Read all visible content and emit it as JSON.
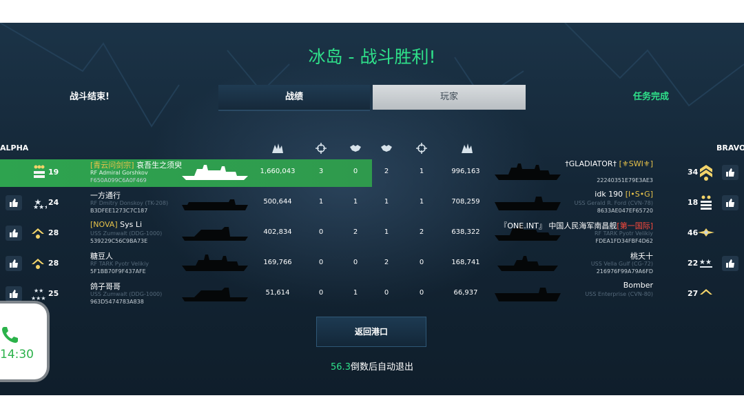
{
  "header": {
    "title": "冰岛 - 战斗胜利!"
  },
  "tabs": {
    "battle_over": "战斗结束!",
    "stats": "战绩",
    "players": "玩家",
    "mission": "任务完成"
  },
  "teams": {
    "alpha": "ALPHA",
    "bravo": "BRAVO"
  },
  "columns": [
    "damage-icon",
    "crosshair-icon",
    "handshake-icon",
    "handshake-icon",
    "crosshair-icon",
    "damage-icon"
  ],
  "rows": [
    {
      "left": {
        "level": "19",
        "clan": "[青云问剑宗]",
        "name": "哀吾生之须臾",
        "ship": "RF Admiral Gorshkov",
        "id": "F650A099C6A0F469"
      },
      "damage_left": "1,660,043",
      "k1": "3",
      "k2": "0",
      "k3": "2",
      "k4": "1",
      "damage_right": "996,163",
      "right": {
        "name": "†GLADIATOR†",
        "clan": "[⚜SWI⚜]",
        "ship": "",
        "id": "22240351E79E3AE3",
        "level": "34"
      }
    },
    {
      "left": {
        "level": "24",
        "clan": "",
        "name": "一方通行",
        "ship": "RF Dmitry Donskoy (TK-208)",
        "id": "B3DFEE1273C7C187"
      },
      "damage_left": "500,644",
      "k1": "1",
      "k2": "1",
      "k3": "1",
      "k4": "1",
      "damage_right": "708,259",
      "right": {
        "name": "idk 190",
        "clan": "[I•S•G]",
        "ship": "USS Gerald R. Ford (CVN-78)",
        "id": "8633AE047EF65720",
        "level": "18"
      }
    },
    {
      "left": {
        "level": "28",
        "clan": "[NOVA]",
        "name": "Sys Li",
        "ship": "USS Zumwalt (DDG-1000)",
        "id": "539229C56C9BA73E"
      },
      "damage_left": "402,834",
      "k1": "0",
      "k2": "2",
      "k3": "1",
      "k4": "2",
      "damage_right": "638,322",
      "right": {
        "name": "『ONE.INT』 中国人民海军南昌舰",
        "clan": "[第一国际]",
        "ship": "RF TARK Pyotr Velikiy",
        "id": "FDEA1FD34FBF4D62",
        "level": "46"
      }
    },
    {
      "left": {
        "level": "28",
        "clan": "",
        "name": "糖豆人",
        "ship": "RF TARK Pyotr Velikiy",
        "id": "5F1BB70F9F437AFE"
      },
      "damage_left": "169,766",
      "k1": "0",
      "k2": "0",
      "k3": "2",
      "k4": "0",
      "damage_right": "168,741",
      "right": {
        "name": "桃夭十",
        "clan": "",
        "ship": "USS Vella Gulf (CG-72)",
        "id": "216976F99A79A6FD",
        "level": "22"
      }
    },
    {
      "left": {
        "level": "25",
        "clan": "",
        "name": "鸽子哥哥",
        "ship": "USS Zumwalt (DDG-1000)",
        "id": "963D5474783A838"
      },
      "damage_left": "51,614",
      "k1": "0",
      "k2": "1",
      "k3": "0",
      "k4": "0",
      "damage_right": "66,937",
      "right": {
        "name": "Bomber",
        "clan": "",
        "ship": "USS Enterprise (CVN-80)",
        "id": "",
        "level": "27"
      }
    }
  ],
  "return_button": "返回港口",
  "countdown": {
    "seconds": "56.3",
    "text": "倒数后自动退出"
  },
  "call_widget": {
    "time": "14:30"
  },
  "colors": {
    "accent_green": "#2fe08a",
    "highlight_row": "#2ea34f",
    "clan_gold": "#e8c34a",
    "clan_red": "#ff4a3c"
  }
}
